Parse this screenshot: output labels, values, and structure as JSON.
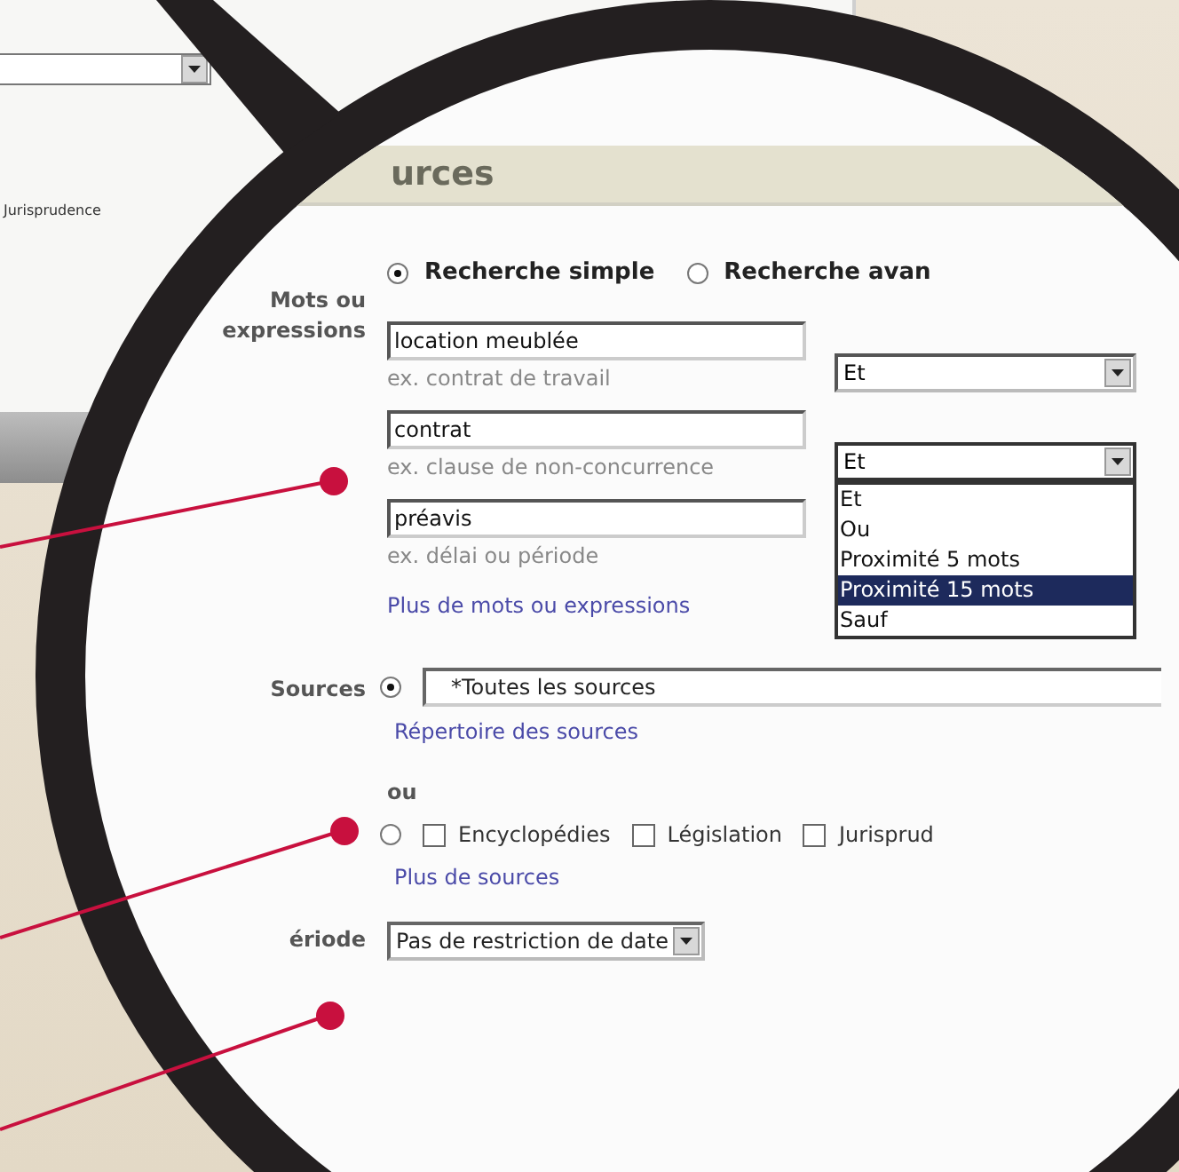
{
  "background_window": {
    "checkbox_label": "Jurisprudence"
  },
  "header": {
    "title": "urces"
  },
  "search_mode": [
    {
      "label": "Recherche simple",
      "selected": true
    },
    {
      "label": "Recherche avan",
      "selected": false
    }
  ],
  "terms": {
    "label": "Mots ou expressions",
    "fields": [
      {
        "value": "location meublée",
        "hint": "ex. contrat de travail"
      },
      {
        "value": "contrat",
        "hint": "ex. clause de non-concurrence"
      },
      {
        "value": "préavis",
        "hint": "ex. délai ou période"
      }
    ],
    "operators": [
      {
        "value": "Et",
        "open": false
      },
      {
        "value": "Et",
        "open": true
      }
    ],
    "operator_options": [
      {
        "label": "Et",
        "selected": false
      },
      {
        "label": "Ou",
        "selected": false
      },
      {
        "label": "Proximité 5 mots",
        "selected": false
      },
      {
        "label": "Proximité 15 mots",
        "selected": true
      },
      {
        "label": "Sauf",
        "selected": false
      }
    ],
    "more_link": "Plus de mots ou expressions"
  },
  "sources": {
    "label": "Sources",
    "all_option": {
      "selected": true,
      "value": "*Toutes les sources",
      "link": "Répertoire des sources"
    },
    "or_label": "ou",
    "types_option": {
      "selected": false,
      "link": "Plus de sources",
      "types": [
        {
          "label": "Encyclopédies",
          "checked": false
        },
        {
          "label": "Législation",
          "checked": false
        },
        {
          "label": "Jurisprud",
          "checked": false
        }
      ]
    }
  },
  "period": {
    "label": "ériode",
    "value": "Pas de restriction de date"
  }
}
